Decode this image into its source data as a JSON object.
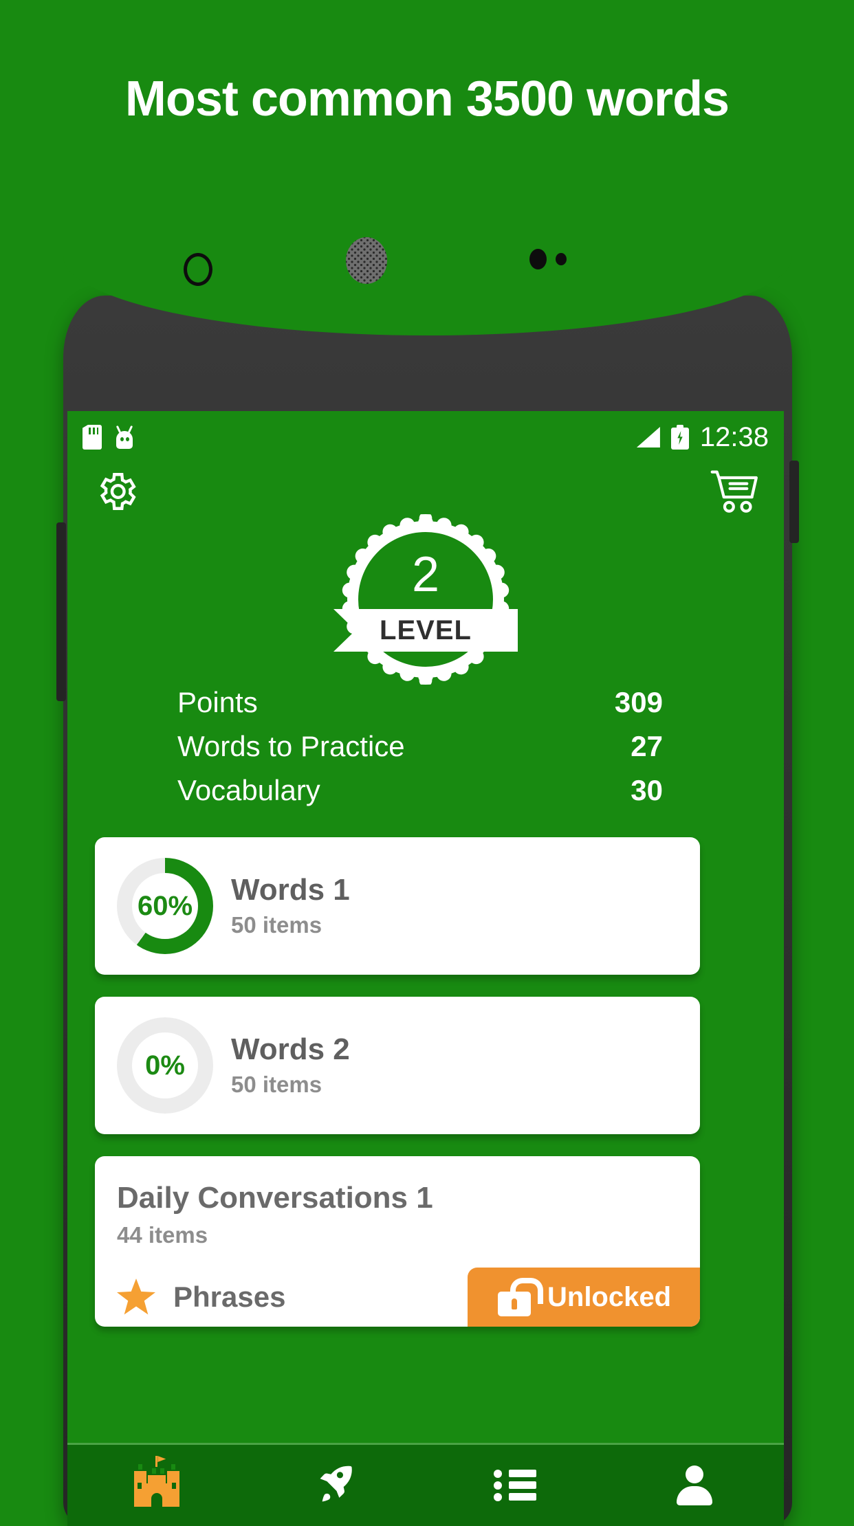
{
  "headline": "Most common 3500 words",
  "statusbar": {
    "sd_icon": "sd-card-icon",
    "android_icon": "android-mascot-icon",
    "signal_icon": "signal-strength-icon",
    "battery_icon": "battery-charging-icon",
    "time": "12:38"
  },
  "toolbar": {
    "settings_icon": "gear-icon",
    "cart_icon": "shopping-cart-icon"
  },
  "badge": {
    "level_number": "2",
    "level_label": "LEVEL"
  },
  "stats": [
    {
      "label": "Points",
      "value": "309"
    },
    {
      "label": "Words to Practice",
      "value": "27"
    },
    {
      "label": "Vocabulary",
      "value": "30"
    }
  ],
  "cards": [
    {
      "percent_label": "60%",
      "percent": 60,
      "title": "Words 1",
      "subtitle": "50 items"
    },
    {
      "percent_label": "0%",
      "percent": 0,
      "title": "Words 2",
      "subtitle": "50 items"
    }
  ],
  "conversation_card": {
    "title": "Daily Conversations 1",
    "subtitle": "44 items",
    "star_icon": "star-icon",
    "phrases_label": "Phrases",
    "lock_icon": "unlock-icon",
    "unlocked_label": "Unlocked"
  },
  "bottom_nav": [
    {
      "icon": "castle-icon",
      "active": true
    },
    {
      "icon": "rocket-icon",
      "active": false
    },
    {
      "icon": "list-icon",
      "active": false
    },
    {
      "icon": "person-icon",
      "active": false
    }
  ],
  "colors": {
    "brand_green": "#188A11",
    "nav_green": "#0D6A0A",
    "accent_orange": "#F0922F",
    "star_orange": "#F5A033",
    "card_white": "#FFFFFF"
  }
}
